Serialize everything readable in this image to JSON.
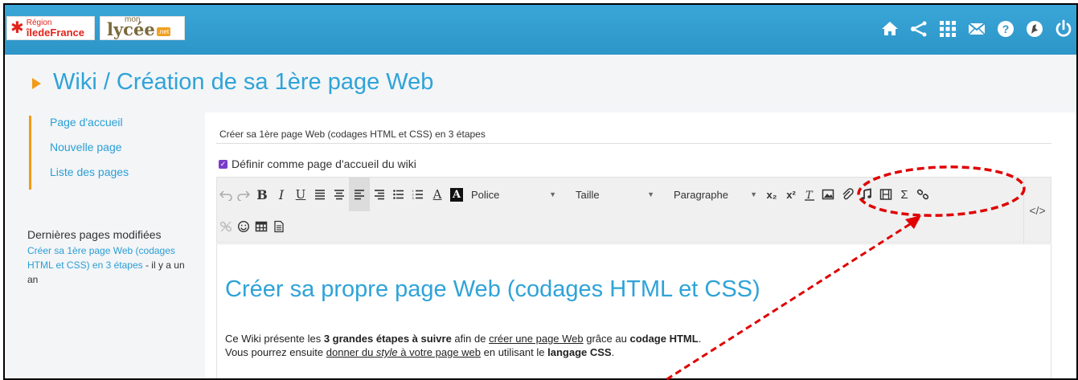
{
  "header": {
    "logo_region_line1": "Région",
    "logo_region_line2": "îledeFrance",
    "logo_lycee_mon": "mon",
    "logo_lycee": "lycée",
    "logo_lycee_net": ".net",
    "icons": [
      "home-icon",
      "share-icon",
      "apps-grid-icon",
      "mail-icon",
      "help-icon",
      "user-avatar-icon",
      "power-icon"
    ]
  },
  "page": {
    "title": "Wiki / Création de sa 1ère page Web"
  },
  "sidebar": {
    "nav": [
      {
        "label": "Page d'accueil"
      },
      {
        "label": "Nouvelle page"
      },
      {
        "label": "Liste des pages"
      }
    ],
    "recent_heading": "Dernières pages modifiées",
    "recent_link": "Créer sa 1ère page Web (codages HTML et CSS) en 3 étapes",
    "recent_time": " - il y a un an"
  },
  "form": {
    "page_name": "Créer sa 1ère page Web (codages HTML et CSS) en 3 étapes",
    "checkbox_label": "Définir comme page d'accueil du wiki",
    "checkbox_checked": true
  },
  "toolbar": {
    "bold": "B",
    "italic": "I",
    "underline": "U",
    "text_color": "A",
    "bg_color": "A",
    "font_label": "Police",
    "size_label": "Taille",
    "format_label": "Paragraphe",
    "subscript": "x₂",
    "superscript": "x²",
    "sigma": "Σ",
    "code_label": "</>"
  },
  "editor": {
    "heading": "Créer sa propre page Web (codages HTML et CSS)",
    "line1_a": "Ce Wiki présente les ",
    "line1_b": "3 grandes étapes à suivre",
    "line1_c": " afin de ",
    "line1_d": "créer une page Web",
    "line1_e": " grâce au ",
    "line1_f": "codage HTML",
    "line1_g": ".",
    "line2_a": "Vous pourrez ensuite ",
    "line2_b": "donner du ",
    "line2_c": "style",
    "line2_d": " à votre page web",
    "line2_e": " en utilisant le ",
    "line2_f": "langage CSS",
    "line2_g": "."
  },
  "colors": {
    "topbar": "#2d95c7",
    "accent_orange": "#f29b18",
    "link_blue": "#2a9ed6",
    "annotation_red": "#e00000"
  }
}
